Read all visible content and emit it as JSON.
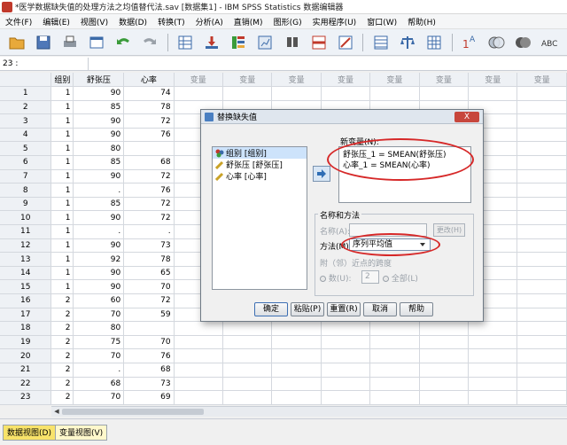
{
  "window": {
    "title": "*医学数据缺失值的处理方法之均值替代法.sav [数据集1] - IBM SPSS Statistics 数据编辑器"
  },
  "menu": [
    "文件(F)",
    "编辑(E)",
    "视图(V)",
    "数据(D)",
    "转换(T)",
    "分析(A)",
    "直销(M)",
    "图形(G)",
    "实用程序(U)",
    "窗口(W)",
    "帮助(H)"
  ],
  "toolbar_icons": [
    "open-icon",
    "save-icon",
    "print-icon",
    "dialog-recall-icon",
    "undo-icon",
    "redo-icon",
    "goto-case-icon",
    "goto-variable-icon",
    "variables-icon",
    "run-descriptive-icon",
    "find-icon",
    "insert-cases-icon",
    "insert-variable-icon",
    "split-file-icon",
    "weight-cases-icon",
    "select-cases-icon",
    "value-labels-icon",
    "use-sets-icon",
    "show-all-icon",
    "spell-icon"
  ],
  "cellbar": {
    "ref": "23 :"
  },
  "grid": {
    "columns": [
      "组别",
      "舒张压",
      "心率",
      "变量",
      "变量",
      "变量",
      "变量",
      "变量",
      "变量",
      "变量",
      "变量"
    ],
    "rows": [
      [
        "1",
        "1",
        "90",
        "74"
      ],
      [
        "2",
        "1",
        "85",
        "78"
      ],
      [
        "3",
        "1",
        "90",
        "72"
      ],
      [
        "4",
        "1",
        "90",
        "76"
      ],
      [
        "5",
        "1",
        "80",
        ""
      ],
      [
        "6",
        "1",
        "85",
        "68"
      ],
      [
        "7",
        "1",
        "90",
        "72"
      ],
      [
        "8",
        "1",
        ".",
        "76"
      ],
      [
        "9",
        "1",
        "85",
        "72"
      ],
      [
        "10",
        "1",
        "90",
        "72"
      ],
      [
        "11",
        "1",
        ".",
        "."
      ],
      [
        "12",
        "1",
        "90",
        "73"
      ],
      [
        "13",
        "1",
        "92",
        "78"
      ],
      [
        "14",
        "1",
        "90",
        "65"
      ],
      [
        "15",
        "1",
        "90",
        "70"
      ],
      [
        "16",
        "2",
        "60",
        "72"
      ],
      [
        "17",
        "2",
        "70",
        "59"
      ],
      [
        "18",
        "2",
        "80",
        ""
      ],
      [
        "19",
        "2",
        "75",
        "70"
      ],
      [
        "20",
        "2",
        "70",
        "76"
      ],
      [
        "21",
        "2",
        ".",
        "68"
      ],
      [
        "22",
        "2",
        "68",
        "73"
      ],
      [
        "23",
        "2",
        "70",
        "69"
      ]
    ]
  },
  "tabs": {
    "data_view": "数据视图(D)",
    "variable_view": "变量视图(V)"
  },
  "dialog": {
    "title": "替换缺失值",
    "close": "X",
    "source_vars": [
      "组别 [组别]",
      "舒张压 [舒张压]",
      "心率 [心率]"
    ],
    "new_var_label": "新变量(N):",
    "new_vars": [
      "舒张压_1 = SMEAN(舒张压)",
      "心率_1 = SMEAN(心率)"
    ],
    "name_method_group": "名称和方法",
    "name_label": "名称(A):",
    "change_button": "更改(H)",
    "method_label": "方法(M):",
    "method_value": "序列平均值",
    "span_label": "附（邻）近点的跨度",
    "number_label": "数(U):",
    "number_value": "2",
    "all_label": "全部(L)",
    "buttons": {
      "ok": "确定",
      "paste": "粘贴(P)",
      "reset": "重置(R)",
      "cancel": "取消",
      "help": "帮助"
    }
  }
}
